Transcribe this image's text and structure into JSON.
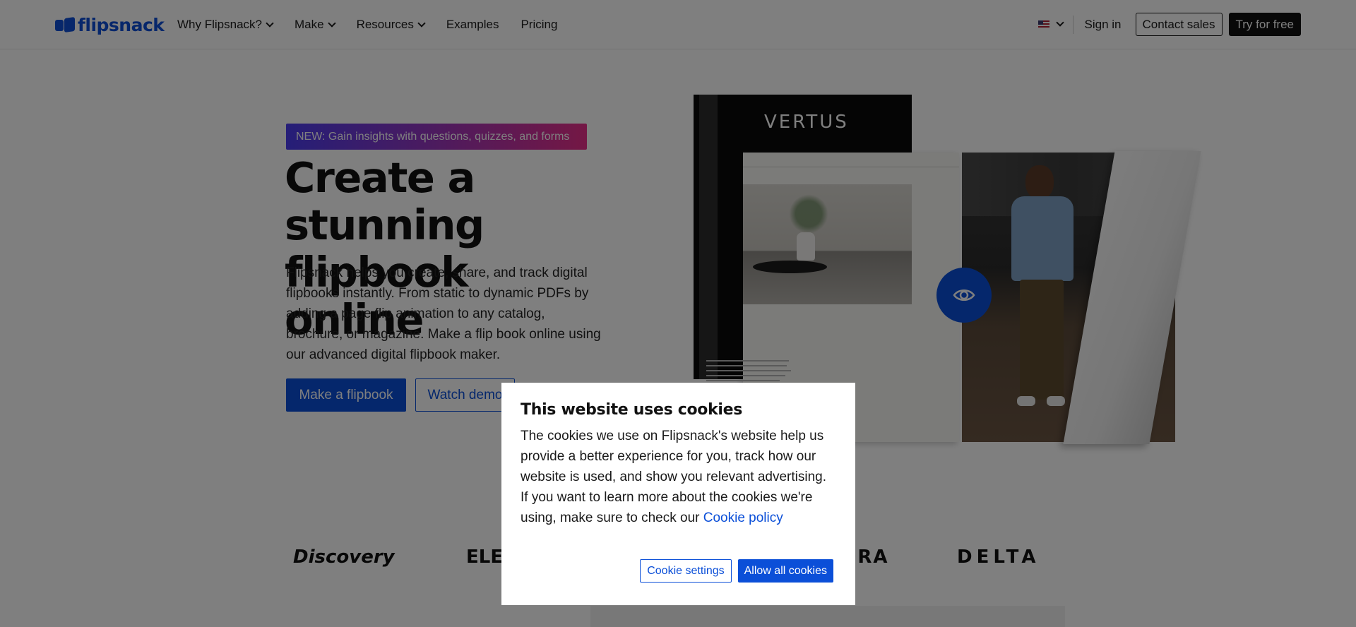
{
  "header": {
    "logo_text": "flipsnack",
    "nav": [
      {
        "label": "Why Flipsnack?",
        "dropdown": true
      },
      {
        "label": "Make",
        "dropdown": true
      },
      {
        "label": "Resources",
        "dropdown": true
      },
      {
        "label": "Examples",
        "dropdown": false
      },
      {
        "label": "Pricing",
        "dropdown": false
      }
    ],
    "language_icon": "us-flag-icon",
    "sign_in": "Sign in",
    "contact_sales": "Contact sales",
    "try_free": "Try for free"
  },
  "hero": {
    "badge": "NEW: Gain insights with questions, quizzes, and forms",
    "title_line1": "Create a stunning",
    "title_line2": "flipbook online",
    "description": "Flipsnack helps you create, share, and track digital flipbooks instantly. From static to dynamic PDFs by adding a page flip animation to any catalog, brochure, or magazine. Make a flip book online using our advanced digital flipbook maker.",
    "primary_cta": "Make a flipbook",
    "secondary_cta": "Watch demo"
  },
  "illustration": {
    "cover_brand": "VERTUS",
    "preview_icon": "eye-icon"
  },
  "logos": [
    "Discovery",
    "ELECTROLUX",
    "SEPHORA",
    "DELTA"
  ],
  "cookie_modal": {
    "title": "This website uses cookies",
    "body": "The cookies we use on Flipsnack's website help us provide a better experience for you, track how our website is used, and show you relevant advertising. If you want to learn more about the cookies we're using, make sure to check our",
    "policy_link": "Cookie policy",
    "settings_button": "Cookie settings",
    "allow_button": "Allow all cookies"
  },
  "colors": {
    "brand_blue": "#0b4fd8",
    "badge_gradient_start": "#4b3df0",
    "badge_gradient_end": "#e92f8a",
    "overlay": "rgba(0,0,0,0.5)"
  }
}
